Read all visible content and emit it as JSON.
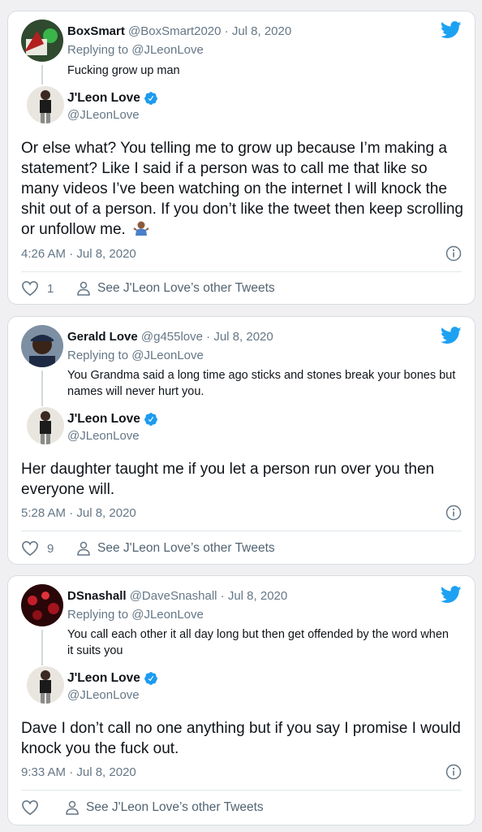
{
  "cards": [
    {
      "reply": {
        "name": "BoxSmart",
        "handle": "@BoxSmart2020",
        "date": "· Jul 8, 2020",
        "replying_prefix": "Replying to ",
        "replying_handle": "@JLeonLove",
        "text": "Fucking grow up man"
      },
      "main": {
        "name": "J'Leon Love",
        "handle": "@JLeonLove",
        "text": "Or else what? You telling me to grow up because I’m making a statement? Like I said if a person was to call me that like so many videos I’ve been watching on the internet I will knock the shit out of a person. If you don’t like the tweet then keep scrolling or unfollow me.",
        "timestamp": "4:26 AM · Jul 8, 2020",
        "likes": "1",
        "other_tweets": "See J'Leon Love’s other Tweets"
      }
    },
    {
      "reply": {
        "name": "Gerald Love",
        "handle": "@g455love",
        "date": "· Jul 8, 2020",
        "replying_prefix": "Replying to ",
        "replying_handle": "@JLeonLove",
        "text": "You Grandma said a long time ago sticks and stones break your bones but names will never hurt you."
      },
      "main": {
        "name": "J'Leon Love",
        "handle": "@JLeonLove",
        "text": "Her daughter taught me if you let a person run over you then everyone will.",
        "timestamp": "5:28 AM · Jul 8, 2020",
        "likes": "9",
        "other_tweets": "See J'Leon Love’s other Tweets"
      }
    },
    {
      "reply": {
        "name": "DSnashall",
        "handle": "@DaveSnashall",
        "date": "· Jul 8, 2020",
        "replying_prefix": "Replying to ",
        "replying_handle": "@JLeonLove",
        "text": "You call each other it all day long but then get offended by the word when it suits you"
      },
      "main": {
        "name": "J'Leon Love",
        "handle": "@JLeonLove",
        "text": "Dave I don’t call no one anything but if you say I promise I would knock you the fuck out.",
        "timestamp": "9:33 AM · Jul 8, 2020",
        "likes": "",
        "other_tweets": "See J'Leon Love’s other Tweets"
      }
    }
  ],
  "colors": {
    "twitter_blue": "#1da1f2",
    "muted": "#657786",
    "verified": "#1d9bf0"
  },
  "icons": [
    "twitter-bird-icon",
    "verified-badge-icon",
    "info-icon",
    "heart-icon",
    "person-icon",
    "person-shrugging-emoji"
  ]
}
